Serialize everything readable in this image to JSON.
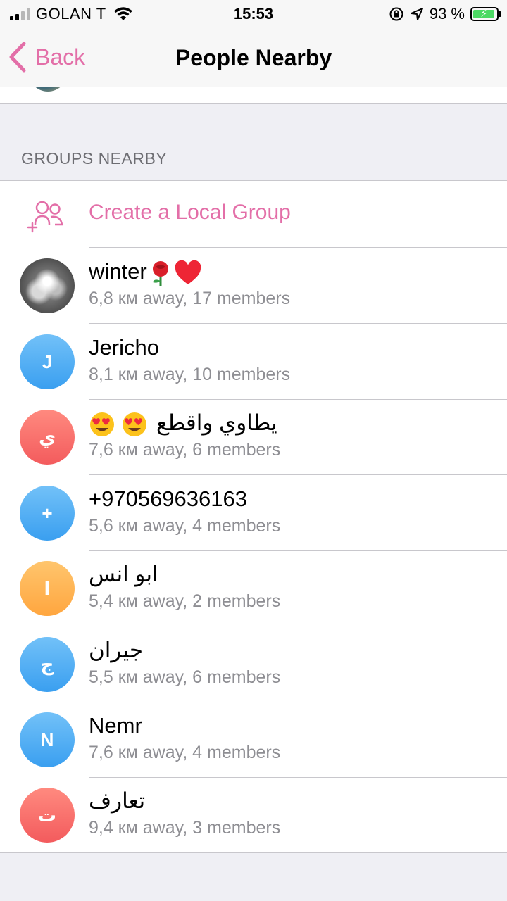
{
  "status_bar": {
    "carrier": "GOLAN T",
    "time": "15:53",
    "battery_percent": "93 %",
    "battery_level": 0.93,
    "signal_bars_filled": 2,
    "signal_bars_total": 4,
    "icons": [
      "signal-icon",
      "wifi-icon",
      "rotation-lock-icon",
      "location-arrow-icon",
      "battery-charging-icon"
    ]
  },
  "nav": {
    "back_label": "Back",
    "title": "People Nearby"
  },
  "section": {
    "header": "GROUPS NEARBY"
  },
  "create_group": {
    "label": "Create a Local Group",
    "icon": "add-group-icon"
  },
  "groups": [
    {
      "name": "winter",
      "name_emoji": [
        "rose-emoji",
        "heart-emoji"
      ],
      "subtitle": "6,8 км away, 17 members",
      "avatar": "photo"
    },
    {
      "name": "Jericho",
      "subtitle": "8,1 км away, 10 members",
      "avatar": "J"
    },
    {
      "name": "يطاوي واقطع",
      "name_emoji": [
        "heart-eyes-emoji",
        "heart-eyes-emoji"
      ],
      "subtitle": "7,6 км away, 6 members",
      "avatar": "ي"
    },
    {
      "name": "+970569636163",
      "subtitle": "5,6 км away, 4 members",
      "avatar": "+"
    },
    {
      "name": "ابو انس",
      "subtitle": "5,4 км away, 2 members",
      "avatar": "ا"
    },
    {
      "name": "جيران",
      "subtitle": "5,5 км away, 6 members",
      "avatar": "ج"
    },
    {
      "name": "Nemr",
      "subtitle": "7,6 км away, 4 members",
      "avatar": "N"
    },
    {
      "name": "تعارف",
      "subtitle": "9,4 км away, 3 members",
      "avatar": "ت"
    }
  ],
  "colors": {
    "accent": "#e36fa8",
    "avatar_blue": "#3a9ff0",
    "avatar_red": "#f35b5d",
    "avatar_orange": "#ffa63f",
    "subtitle_gray": "#8e8e93"
  }
}
